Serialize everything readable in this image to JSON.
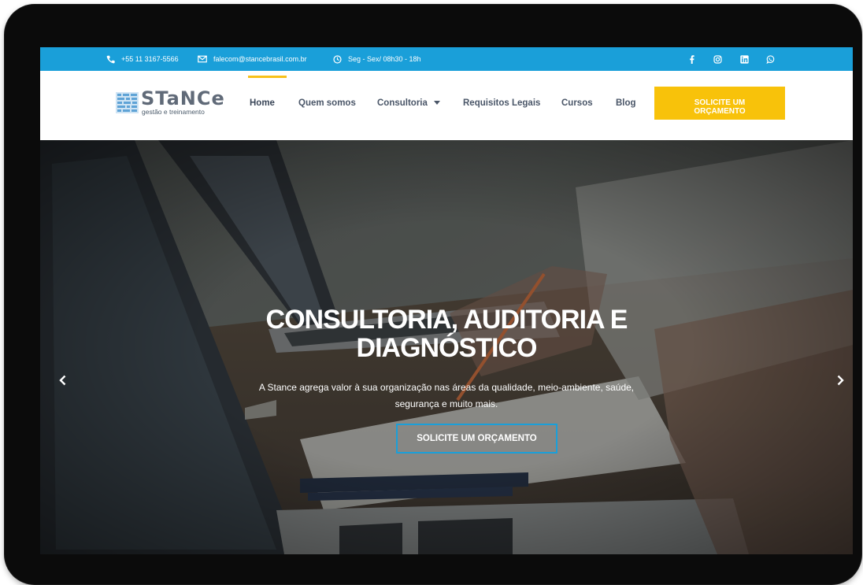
{
  "topbar": {
    "phone": "+55 11 3167-5566",
    "email": "falecom@stancebrasil.com.br",
    "hours": "Seg - Sex/ 08h30 - 18h",
    "icons": [
      "phone-icon",
      "mail-icon",
      "clock-icon"
    ],
    "social": [
      "facebook-icon",
      "instagram-icon",
      "linkedin-icon",
      "whatsapp-icon"
    ],
    "color": "#1a9fd9"
  },
  "header": {
    "logo_word": "STaNCe",
    "logo_sub": "gestão e treinamento",
    "nav": [
      "Home",
      "Quem somos",
      "Consultoria",
      "Requisitos Legais",
      "Cursos",
      "Blog"
    ],
    "active": "Home",
    "cta": "SOLICITE UM ORÇAMENTO",
    "accent": "#f8c20a"
  },
  "hero": {
    "title": "CONSULTORIA, AUDITORIA E DIAGNÓSTICO",
    "text": "A Stance agrega valor à sua organização nas áreas da qualidade, meio-ambiente, saúde, segurança e muito mais.",
    "button": "SOLICITE UM ORÇAMENTO",
    "prev_icon": "chevron-left-icon",
    "next_icon": "chevron-right-icon"
  }
}
